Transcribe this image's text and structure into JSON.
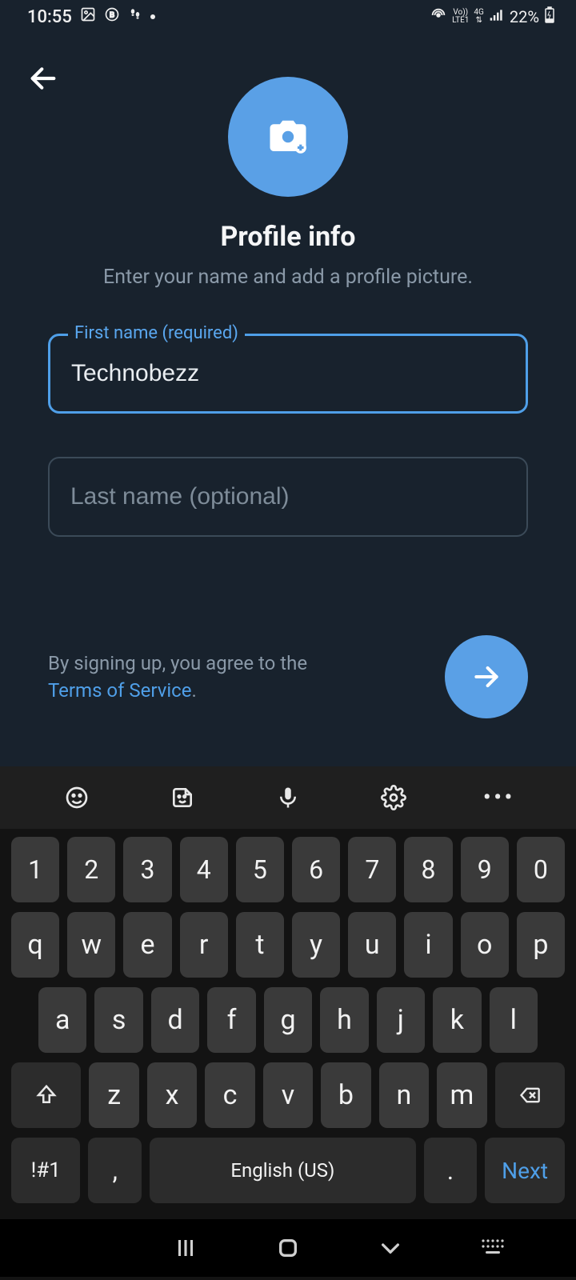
{
  "status": {
    "time": "10:55",
    "battery": "22%",
    "network": "4G",
    "lte": "LTE1",
    "vo": "Vo))"
  },
  "header": {
    "title": "Profile info",
    "subtitle": "Enter your name and add a profile picture."
  },
  "form": {
    "firstName": {
      "label": "First name (required)",
      "value": "Technobezz"
    },
    "lastName": {
      "placeholder": "Last name (optional)",
      "value": ""
    }
  },
  "terms": {
    "prefix": "By signing up, you agree to the ",
    "linkText": "Terms of Service",
    "suffix": "."
  },
  "keyboard": {
    "row1": [
      "1",
      "2",
      "3",
      "4",
      "5",
      "6",
      "7",
      "8",
      "9",
      "0"
    ],
    "row2": [
      "q",
      "w",
      "e",
      "r",
      "t",
      "y",
      "u",
      "i",
      "o",
      "p"
    ],
    "row3": [
      "a",
      "s",
      "d",
      "f",
      "g",
      "h",
      "j",
      "k",
      "l"
    ],
    "row4": [
      "z",
      "x",
      "c",
      "v",
      "b",
      "n",
      "m"
    ],
    "sym": "!#1",
    "comma": ",",
    "space": "English (US)",
    "period": ".",
    "next": "Next"
  }
}
